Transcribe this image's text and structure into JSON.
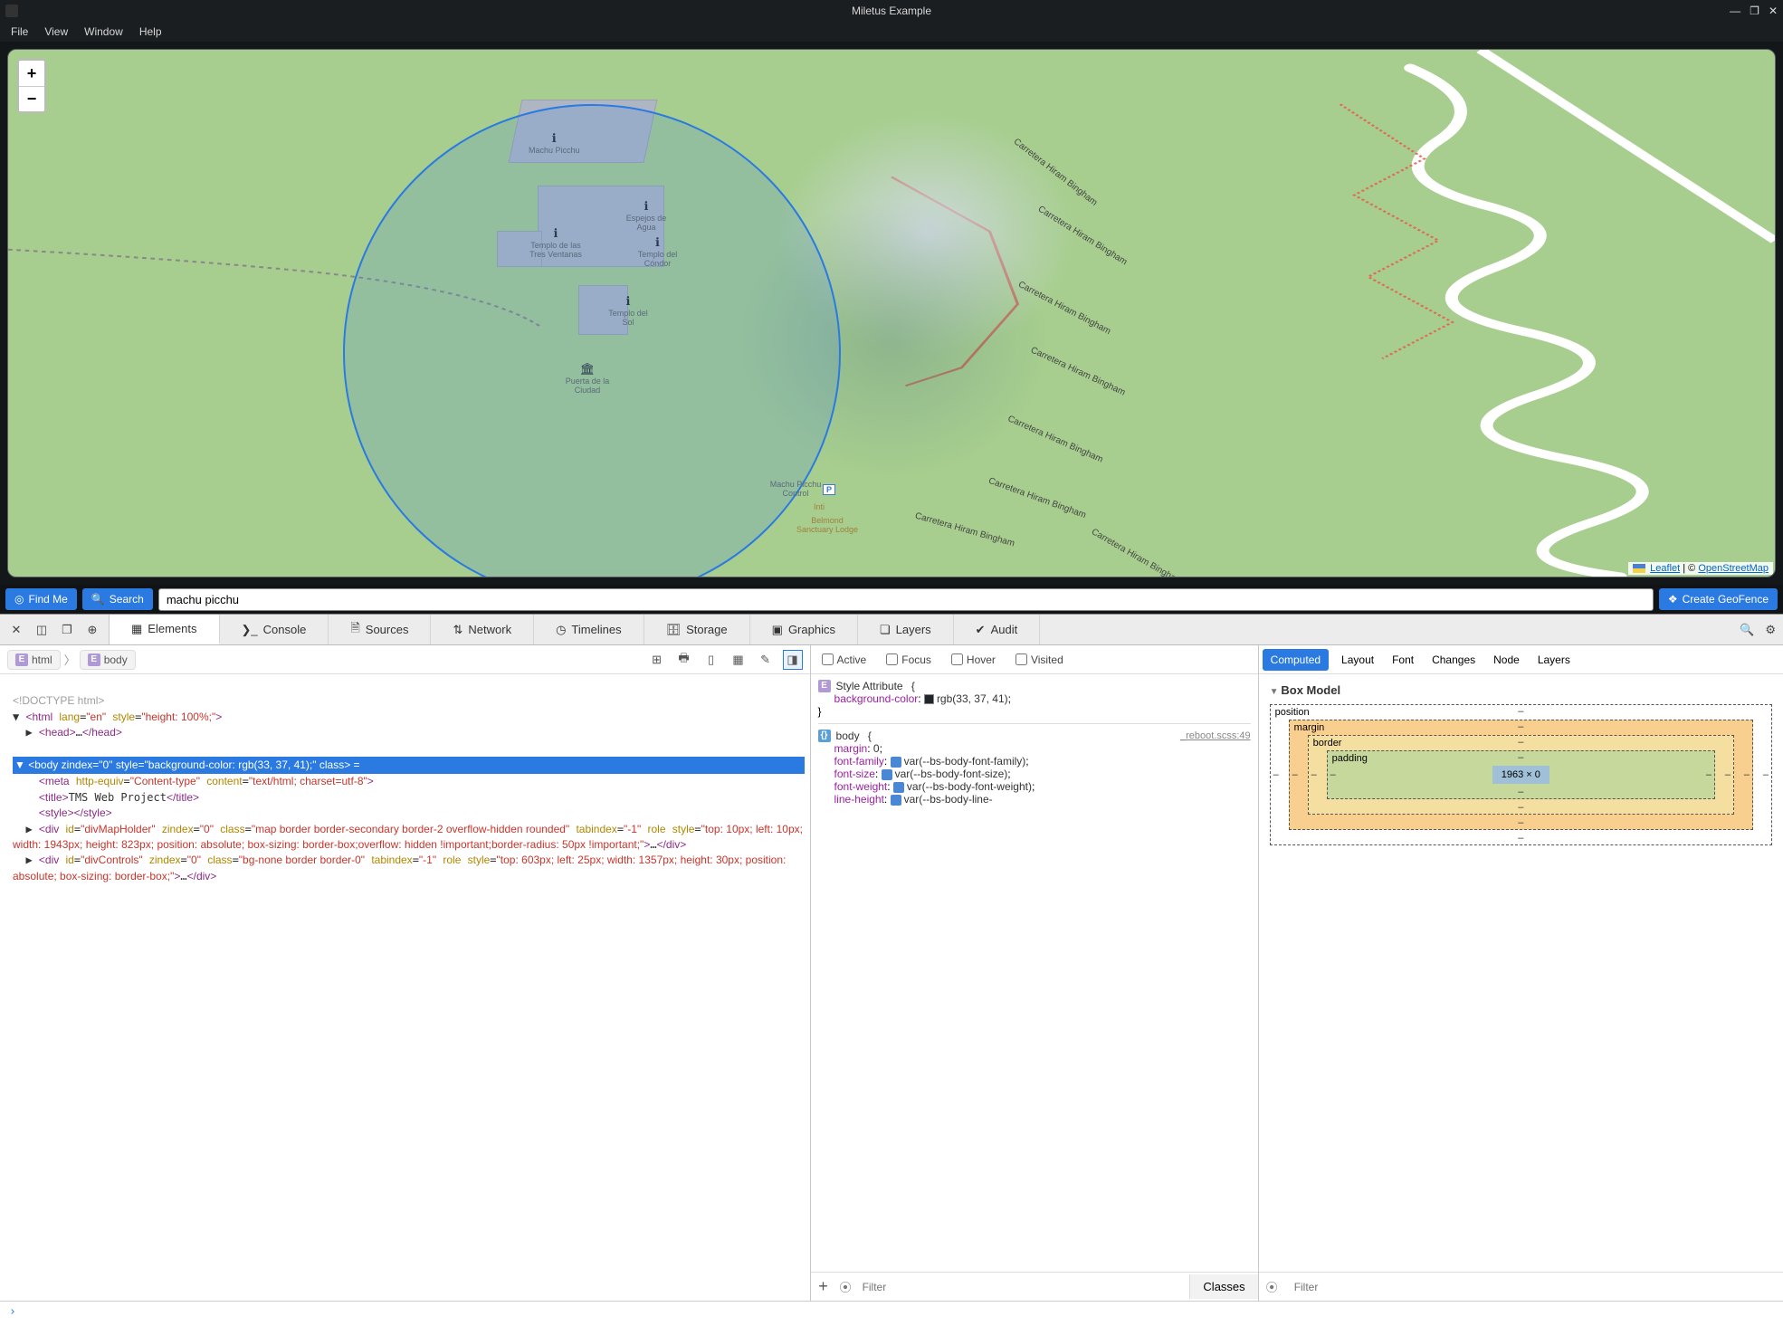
{
  "window": {
    "title": "Miletus Example",
    "menu": [
      "File",
      "View",
      "Window",
      "Help"
    ],
    "controls": {
      "min": "—",
      "max": "❐",
      "close": "✕"
    }
  },
  "map": {
    "zoom_in": "+",
    "zoom_out": "−",
    "attribution": {
      "leaflet": "Leaflet",
      "sep": " | © ",
      "osm": "OpenStreetMap"
    },
    "roads": [
      "Carretera Hiram Bingham",
      "Carretera Hiram Bingham",
      "Carretera Hiram Bingham",
      "Carretera Hiram Bingham",
      "Carretera Hiram Bingham",
      "Carretera Hiram Bingham",
      "Carretera Hiram Bingham",
      "Carretera Hiram Bingham"
    ],
    "pois": [
      {
        "label": "Machu Picchu"
      },
      {
        "label": "Templo de las Tres Ventanas"
      },
      {
        "label": "Espejos de Agua"
      },
      {
        "label": "Templo del Cóndor"
      },
      {
        "label": "Templo del Sol"
      },
      {
        "label": "Puerta de la Ciudad"
      },
      {
        "label": "Machu Picchu Control"
      },
      {
        "label": "Inti"
      },
      {
        "label": "Belmond Sanctuary Lodge"
      }
    ],
    "parking": "P"
  },
  "toolbar": {
    "find_me": "Find Me",
    "search": "Search",
    "search_value": "machu picchu",
    "create_geofence": "Create GeoFence"
  },
  "devtools": {
    "tabs": [
      "Elements",
      "Console",
      "Sources",
      "Network",
      "Timelines",
      "Storage",
      "Graphics",
      "Layers",
      "Audit"
    ],
    "breadcrumb": {
      "html": "html",
      "body": "body"
    },
    "dom": {
      "doctype": "<!DOCTYPE html>",
      "html_open": "<html lang=\"en\" style=\"height: 100%;\">",
      "head": "<head>…</head>",
      "body_open": "<body zindex=\"0\" style=\"background-color: rgb(33, 37, 41);\" class> = ",
      "meta": "<meta http-equiv=\"Content-type\" content=\"text/html; charset=utf-8\">",
      "title": "<title>TMS Web Project</title>",
      "style": "<style></style>",
      "div1": "▶ <div id=\"divMapHolder\" zindex=\"0\" class=\"map border border-secondary border-2 overflow-hidden rounded\" tabindex=\"-1\" role style=\"top: 10px; left: 10px; width: 1943px; height: 823px; position: absolute; box-sizing: border-box;overflow: hidden !important;border-radius: 50px !important;\">…</div>",
      "div2": "▶ <div id=\"divControls\" zindex=\"0\" class=\"bg-none border border-0\" tabindex=\"-1\" role style=\"top: 603px; left: 25px; width: 1357px; height: 30px; position: absolute; box-sizing: border-box;\">…</div>"
    },
    "states": [
      "Active",
      "Focus",
      "Hover",
      "Visited"
    ],
    "style_attribute": {
      "title": "Style Attribute",
      "bg_name": "background-color",
      "bg_val": "rgb(33, 37, 41)"
    },
    "body_rule": {
      "selector": "body",
      "source": "_reboot.scss:49",
      "props": [
        {
          "name": "margin",
          "val": "0"
        },
        {
          "name": "font-family",
          "val": "var(--bs-body-font-family)",
          "var": true
        },
        {
          "name": "font-size",
          "val": "var(--bs-body-font-size)",
          "var": true
        },
        {
          "name": "font-weight",
          "val": "var(--bs-body-font-weight)",
          "var": true
        },
        {
          "name": "line-height",
          "val": "var(--bs-body-line-",
          "var": true
        }
      ]
    },
    "filter_placeholder": "Filter",
    "classes": "Classes",
    "computed_tabs": [
      "Computed",
      "Layout",
      "Font",
      "Changes",
      "Node",
      "Layers"
    ],
    "box_model": {
      "title": "Box Model",
      "labels": {
        "position": "position",
        "margin": "margin",
        "border": "border",
        "padding": "padding"
      },
      "content": "1963 × 0",
      "dash": "–"
    },
    "console_prompt": "›"
  }
}
